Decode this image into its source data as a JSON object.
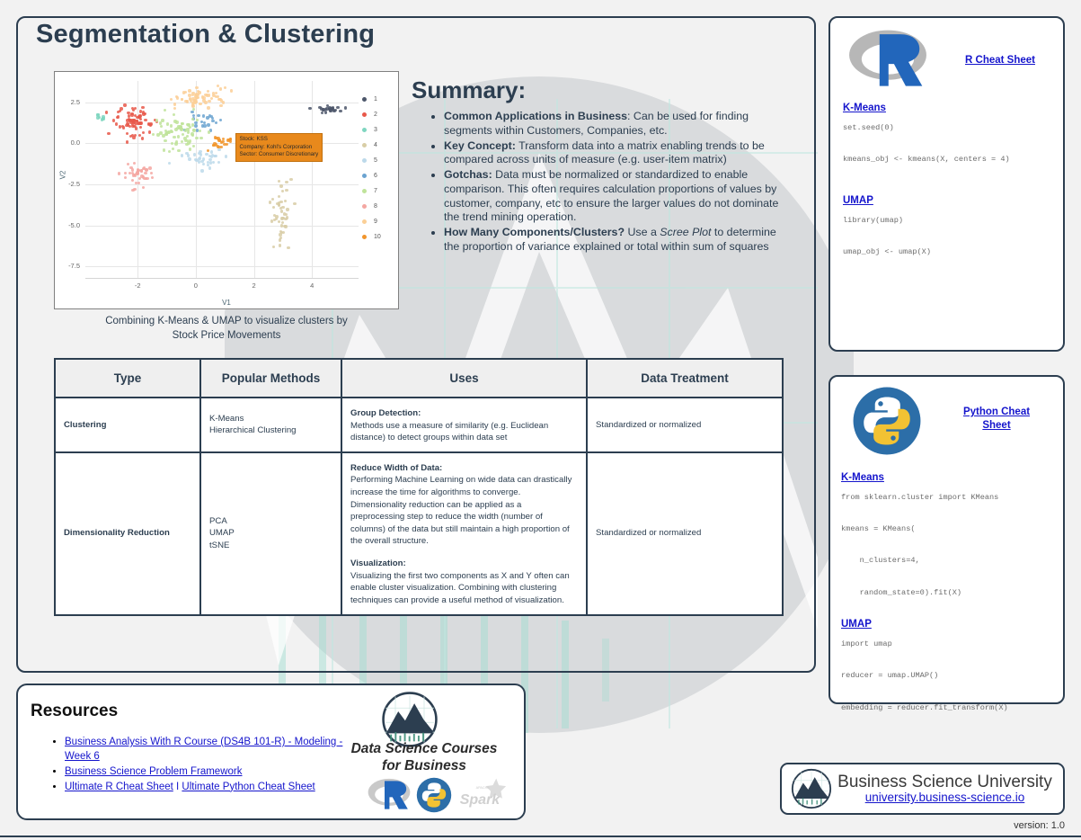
{
  "page": {
    "title": "Segmentation & Clustering",
    "version_label": "version: 1.0"
  },
  "plot": {
    "caption_line1": "Combining K-Means & UMAP to visualize clusters by",
    "caption_line2": "Stock Price Movements",
    "tooltip": {
      "stock": "Stock: KSS",
      "company": "Company: Kohl's Corporation",
      "sector": "Sector: Consumer Discretionary"
    }
  },
  "chart_data": {
    "type": "scatter",
    "title": "Combining K-Means & UMAP to visualize clusters by Stock Price Movements",
    "xlabel": "V1",
    "ylabel": "V2",
    "xlim": [
      -3.8,
      5.6
    ],
    "ylim": [
      -8.2,
      3.8
    ],
    "xticks": [
      "-2",
      "0",
      "2",
      "4"
    ],
    "yticks": [
      "2.5",
      "0.0",
      "-2.5",
      "-5.0",
      "-7.5"
    ],
    "grid": true,
    "legend_position": "right",
    "legend_title": "",
    "legend": [
      {
        "label": "1",
        "color": "#4c566a"
      },
      {
        "label": "2",
        "color": "#e8584a"
      },
      {
        "label": "3",
        "color": "#7fd6c0"
      },
      {
        "label": "4",
        "color": "#d8cda6"
      },
      {
        "label": "5",
        "color": "#bcd9ea"
      },
      {
        "label": "6",
        "color": "#6ba3d0"
      },
      {
        "label": "7",
        "color": "#bfe39a"
      },
      {
        "label": "8",
        "color": "#f4a7a2"
      },
      {
        "label": "9",
        "color": "#fbcf96"
      },
      {
        "label": "10",
        "color": "#f1952c"
      }
    ],
    "clusters": [
      {
        "name": "1",
        "color": "#4c566a",
        "n": 26,
        "cx": 4.55,
        "cy": 2.05,
        "sx": 0.45,
        "sy": 0.17
      },
      {
        "name": "2",
        "color": "#e8584a",
        "n": 78,
        "cx": -2.15,
        "cy": 1.35,
        "sx": 0.58,
        "sy": 0.8
      },
      {
        "name": "3",
        "color": "#7fd6c0",
        "n": 8,
        "cx": -3.25,
        "cy": 1.55,
        "sx": 0.18,
        "sy": 0.15
      },
      {
        "name": "4",
        "color": "#d8cda6",
        "n": 46,
        "cx": 2.95,
        "cy": -4.55,
        "sx": 0.28,
        "sy": 1.85
      },
      {
        "name": "5",
        "color": "#bcd9ea",
        "n": 34,
        "cx": 0.25,
        "cy": -0.95,
        "sx": 0.62,
        "sy": 0.55
      },
      {
        "name": "6",
        "color": "#6ba3d0",
        "n": 22,
        "cx": 0.35,
        "cy": 1.3,
        "sx": 0.45,
        "sy": 0.6
      },
      {
        "name": "7",
        "color": "#bfe39a",
        "n": 72,
        "cx": -0.55,
        "cy": 0.65,
        "sx": 0.78,
        "sy": 0.85
      },
      {
        "name": "8",
        "color": "#f4a7a2",
        "n": 42,
        "cx": -1.95,
        "cy": -1.95,
        "sx": 0.4,
        "sy": 0.55
      },
      {
        "name": "9",
        "color": "#fbcf96",
        "n": 64,
        "cx": 0.1,
        "cy": 2.8,
        "sx": 0.85,
        "sy": 0.5
      },
      {
        "name": "10",
        "color": "#f1952c",
        "n": 24,
        "cx": 0.95,
        "cy": 0.05,
        "sx": 0.45,
        "sy": 0.35
      }
    ]
  },
  "summary": {
    "heading": "Summary:",
    "bullets": [
      {
        "bold": "Common Applications in Business",
        "text": ": Can be used for finding segments within Customers, Companies, etc."
      },
      {
        "bold": "Key Concept:",
        "text": " Transform data into a matrix enabling trends to be compared across units of measure (e.g. user-item matrix)"
      },
      {
        "bold": "Gotchas:",
        "text": " Data must be normalized or standardized to enable comparison. This often requires calculation proportions of values by customer, company, etc to ensure the larger values do not dominate the trend mining operation."
      },
      {
        "bold": "How Many Components/Clusters?",
        "text": " Use a ",
        "italic": "Scree Plot",
        "text2": " to determine the proportion of variance explained or total within sum of squares"
      }
    ]
  },
  "table": {
    "headers": [
      "Type",
      "Popular Methods",
      "Uses",
      "Data Treatment"
    ],
    "rows": [
      {
        "type": "Clustering",
        "methods": "K-Means\nHierarchical Clustering",
        "uses_blocks": [
          {
            "head": "Group Detection:",
            "body": "Methods use a measure of similarity (e.g. Euclidean distance) to detect groups within data set"
          }
        ],
        "treatment": "Standardized or normalized"
      },
      {
        "type": "Dimensionality Reduction",
        "methods": "PCA\nUMAP\ntSNE",
        "uses_blocks": [
          {
            "head": "Reduce Width of Data:",
            "body": "Performing Machine Learning on wide data can drastically increase the time for algorithms to converge. Dimensionality reduction can be applied as a preprocessing step to reduce the width (number of columns) of the data but still maintain a high proportion of the overall structure."
          },
          {
            "head": "Visualization:",
            "body": "Visualizing the first two components as X and Y often can enable cluster visualization. Combining with clustering techniques can provide a useful method of visualization."
          }
        ],
        "treatment": "Standardized or normalized"
      }
    ]
  },
  "r_panel": {
    "cheat_sheet_link": "R Cheat Sheet",
    "sections": [
      {
        "title": "K-Means",
        "code": "set.seed(0)\n\nkmeans_obj <- kmeans(X, centers = 4)"
      },
      {
        "title": "UMAP",
        "code": "library(umap)\n\numap_obj <- umap(X)"
      }
    ]
  },
  "python_panel": {
    "cheat_sheet_link_line1": "Python Cheat",
    "cheat_sheet_link_line2": "Sheet",
    "sections": [
      {
        "title": "K-Means",
        "code": "from sklearn.cluster import KMeans\n\nkmeans = KMeans(\n\n    n_clusters=4,\n\n    random_state=0).fit(X)"
      },
      {
        "title": "UMAP",
        "code": "import umap\n\nreducer = umap.UMAP()\n\nembedding = reducer.fit_transform(X)"
      }
    ]
  },
  "resources": {
    "heading": "Resources",
    "items": [
      {
        "kind": "single",
        "label": "Business Analysis With R Course (DS4B 101-R) - Modeling - Week 6"
      },
      {
        "kind": "single",
        "label": "Business Science Problem Framework"
      },
      {
        "kind": "pair",
        "label": "Ultimate R Cheat Sheet",
        "sep": " I ",
        "label2": "Ultimate Python Cheat Sheet"
      }
    ],
    "brand_line1": "Data Science Courses",
    "brand_line2": "for Business"
  },
  "bsu": {
    "title": "Business Science University",
    "url": "university.business-science.io"
  },
  "colors": {
    "navy": "#2c3e50",
    "link": "#1414cc",
    "tooltip_orange": "#e8891c",
    "header_bg": "#efefef",
    "page_bg": "#f2f2f2"
  }
}
